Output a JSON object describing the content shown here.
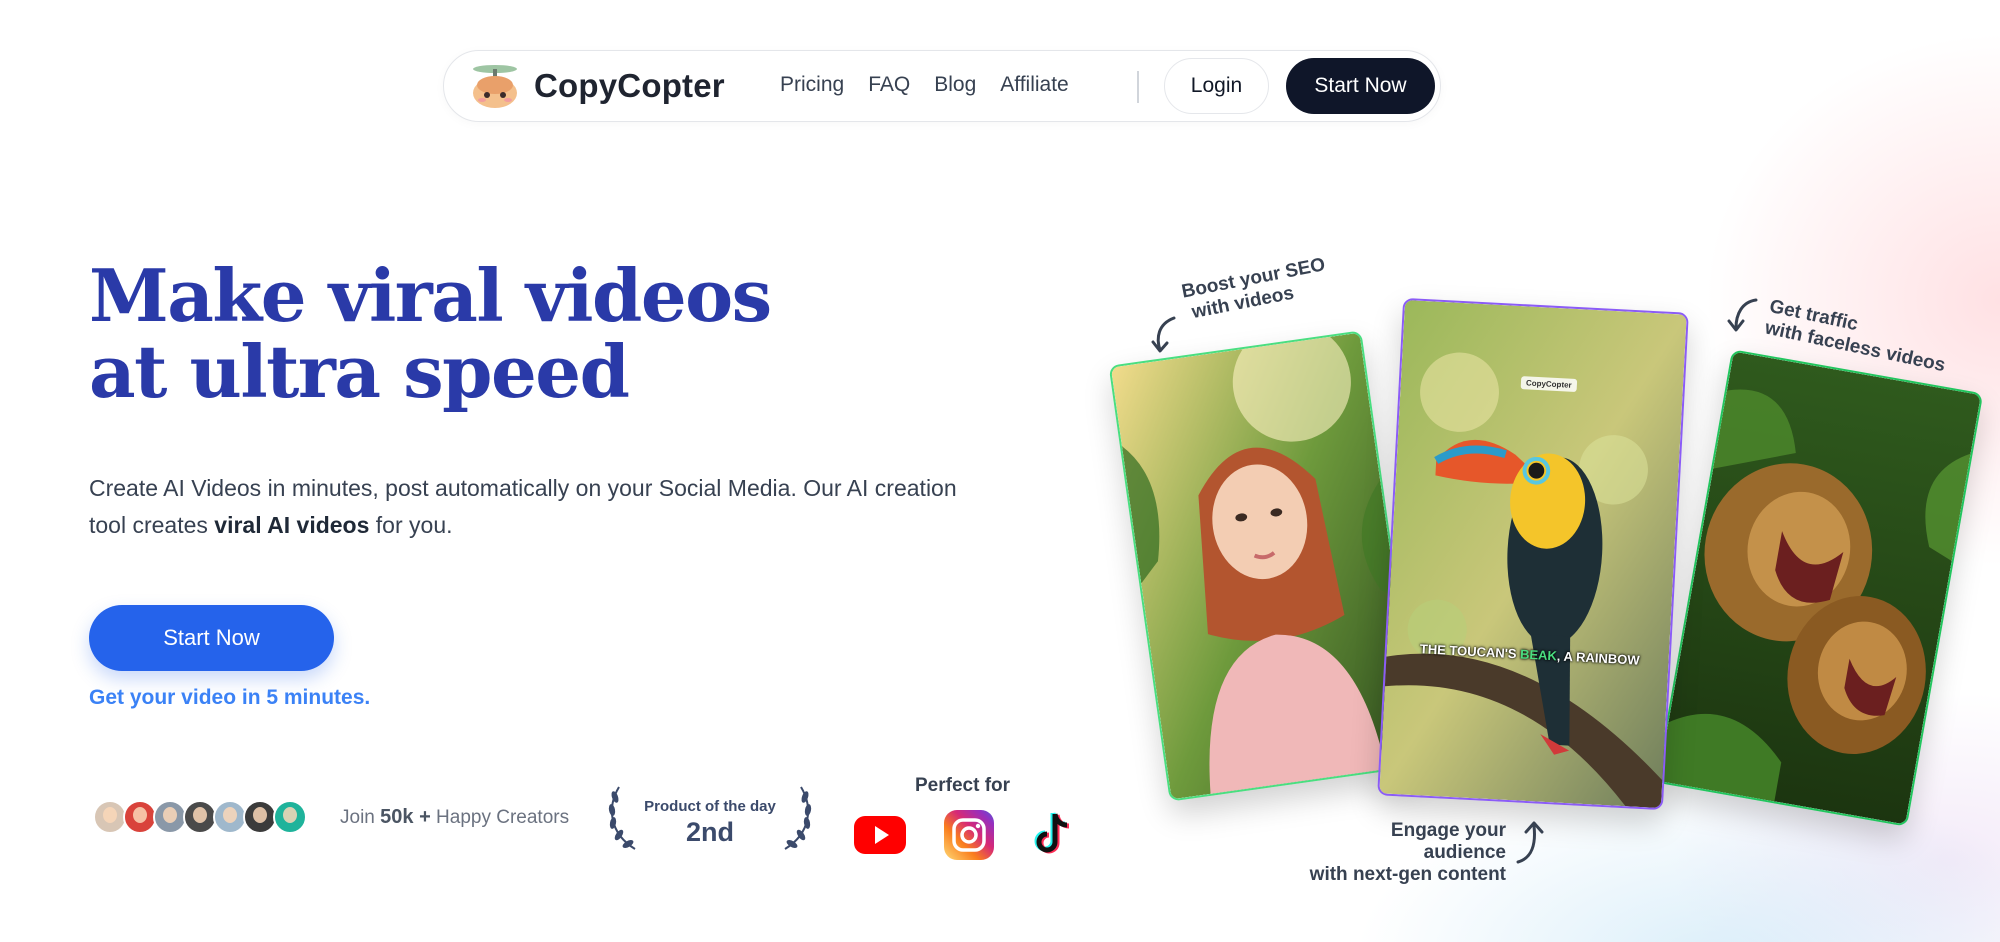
{
  "nav": {
    "brand": "CopyCopter",
    "links": [
      "Pricing",
      "FAQ",
      "Blog",
      "Affiliate"
    ],
    "login_label": "Login",
    "start_label": "Start Now"
  },
  "hero": {
    "headline_line1": "Make viral videos",
    "headline_line2": "at ultra speed",
    "subtext_a": "Create AI Videos in minutes, post automatically on your Social Media. Our AI creation tool creates ",
    "subtext_bold": "viral AI videos",
    "subtext_b": " for you.",
    "cta_label": "Start Now",
    "cta_note": "Get your video in 5 minutes."
  },
  "proof": {
    "join_prefix": "Join",
    "join_count": "50k +",
    "join_suffix": "Happy Creators",
    "product_title": "Product of the day",
    "product_rank": "2nd",
    "perfect_for": "Perfect for",
    "platforms": [
      "youtube-icon",
      "instagram-icon",
      "tiktok-icon"
    ]
  },
  "showcase": {
    "annot_seo_1": "Boost your SEO",
    "annot_seo_2": "with videos",
    "annot_traffic_1": "Get traffic",
    "annot_traffic_2": "with faceless videos",
    "annot_engage_1": "Engage your audience",
    "annot_engage_2": "with next-gen content",
    "watermark": "CopyCopter",
    "caption_a": "THE TOUCAN'S ",
    "caption_hl": "BEAK",
    "caption_b": ", A RAINBOW"
  },
  "colors": {
    "brand_blue": "#2563eb",
    "headline": "#2a3aa8",
    "nav_dark": "#0f1629"
  }
}
